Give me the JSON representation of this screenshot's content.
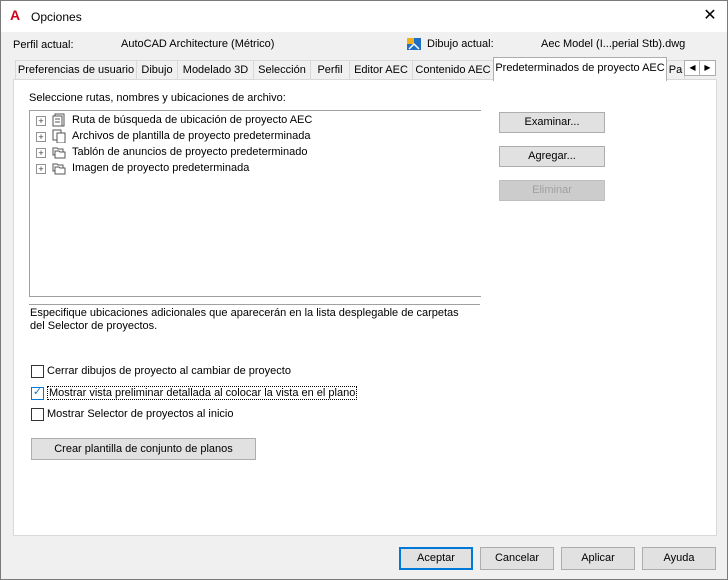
{
  "window": {
    "title": "Opciones"
  },
  "profile": {
    "label": "Perfil actual:",
    "value": "AutoCAD Architecture (Métrico)",
    "drawing_label": "Dibujo actual:",
    "drawing_value": "Aec Model (I...perial Stb).dwg"
  },
  "tabs": [
    {
      "label": "Preferencias de usuario"
    },
    {
      "label": "Dibujo"
    },
    {
      "label": "Modelado 3D"
    },
    {
      "label": "Selección"
    },
    {
      "label": "Perfil"
    },
    {
      "label": "Editor AEC"
    },
    {
      "label": "Contenido AEC"
    },
    {
      "label": "Predeterminados de proyecto AEC"
    },
    {
      "label": "Pa"
    }
  ],
  "main": {
    "tree_label": "Seleccione rutas, nombres y ubicaciones de archivo:",
    "tree_items": [
      {
        "label": "Ruta de búsqueda de ubicación de proyecto AEC",
        "icon": "document-stack-icon"
      },
      {
        "label": "Archivos de plantilla de proyecto predeterminada",
        "icon": "template-files-icon"
      },
      {
        "label": "Tablón de anuncios de proyecto predeterminado",
        "icon": "folder-stack-icon"
      },
      {
        "label": "Imagen de proyecto predeterminada",
        "icon": "folder-stack-icon"
      }
    ],
    "description": "Especifique ubicaciones adicionales que aparecerán en la lista desplegable de carpetas del Selector de proyectos.",
    "buttons": {
      "browse": "Examinar...",
      "add": "Agregar...",
      "remove": "Eliminar"
    },
    "checkboxes": [
      {
        "label": "Cerrar dibujos de proyecto al cambiar de proyecto",
        "checked": false
      },
      {
        "label": "Mostrar vista preliminar detallada al colocar la vista en el plano",
        "checked": true
      },
      {
        "label": "Mostrar Selector de proyectos al inicio",
        "checked": false
      }
    ],
    "create_template": "Crear plantilla de conjunto de planos"
  },
  "footer": {
    "accept": "Aceptar",
    "cancel": "Cancelar",
    "apply": "Aplicar",
    "help": "Ayuda"
  },
  "colors": {
    "accent": "#0078d7",
    "app_logo": "#d0021b"
  }
}
